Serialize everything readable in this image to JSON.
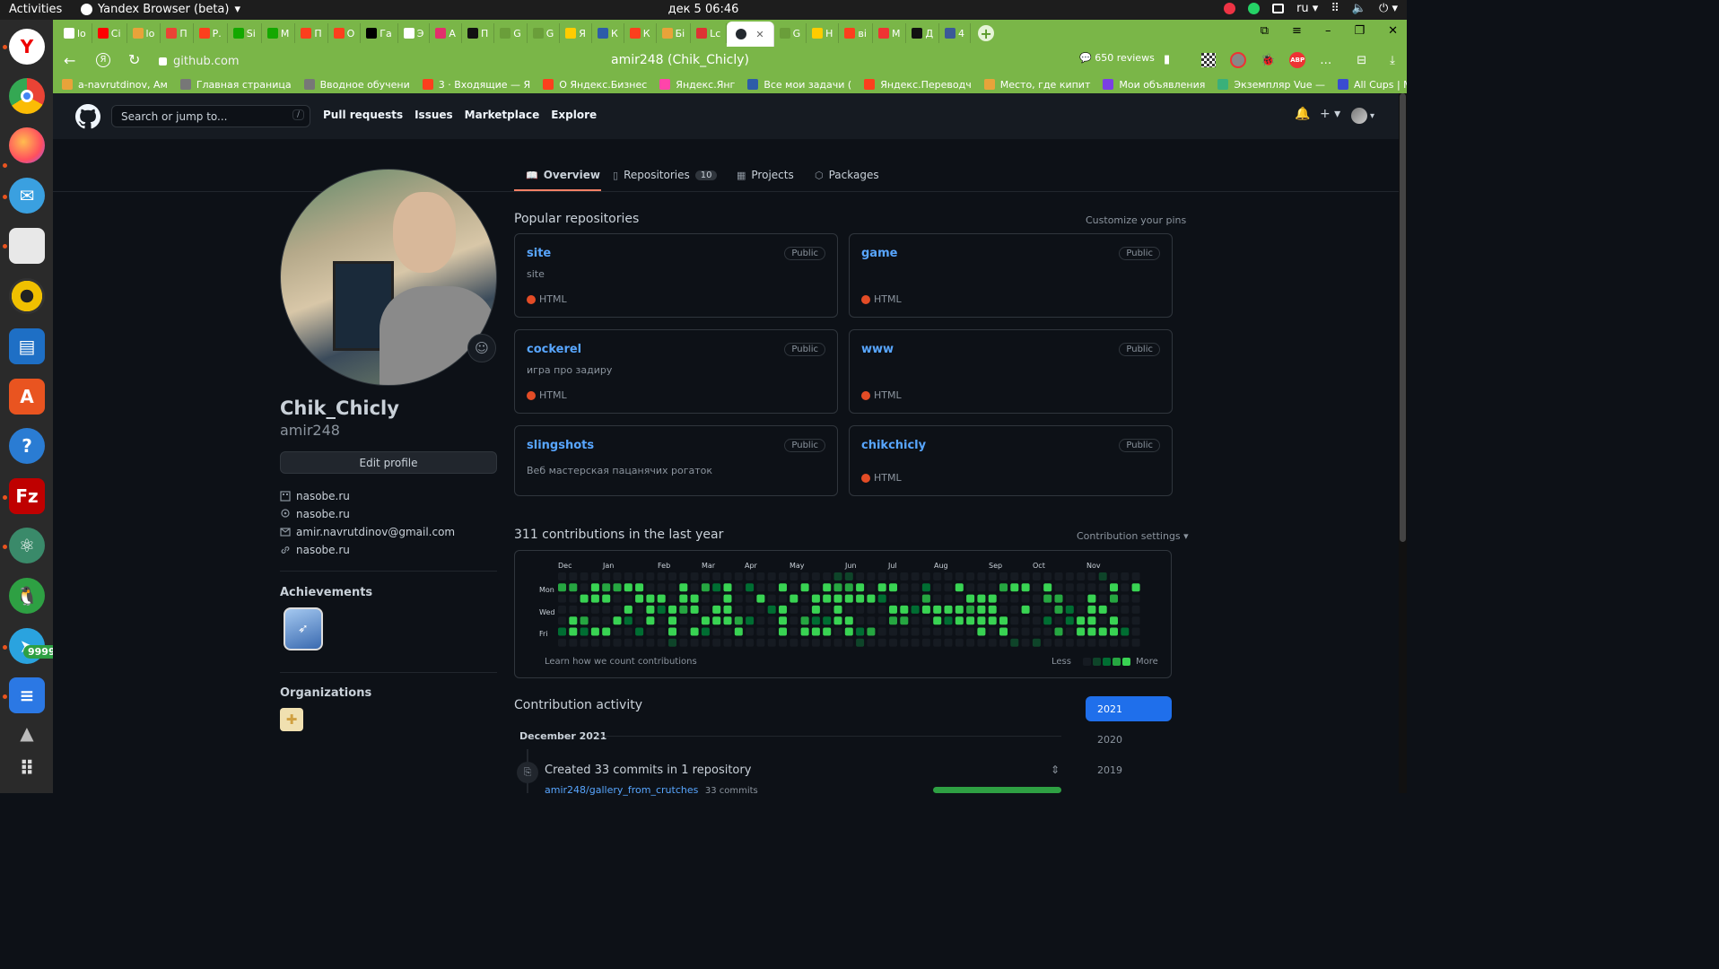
{
  "os": {
    "activities": "Activities",
    "browser_name": "Yandex Browser (beta)",
    "clock": "дек 5  06:46",
    "lang": "ru"
  },
  "browser": {
    "address": "github.com",
    "page_title": "amir248 (Chik_Chicly)",
    "reviews": "650 reviews",
    "tabs": [
      {
        "label": "lo",
        "color": "#ffffff"
      },
      {
        "label": "Ci",
        "color": "#ff0000"
      },
      {
        "label": "lo",
        "color": "#e8a33a"
      },
      {
        "label": "П",
        "color": "#ea4335"
      },
      {
        "label": "Р.",
        "color": "#fc3f1d"
      },
      {
        "label": "Si",
        "color": "#14a800"
      },
      {
        "label": "М",
        "color": "#14a800"
      },
      {
        "label": "П",
        "color": "#fc3f1d"
      },
      {
        "label": "О",
        "color": "#fc3f1d"
      },
      {
        "label": "Га",
        "color": "#000000"
      },
      {
        "label": "Э",
        "color": "#ffffff"
      },
      {
        "label": "А",
        "color": "#e1306c"
      },
      {
        "label": "П",
        "color": "#111111"
      },
      {
        "label": "G",
        "color": "#6a9e3a"
      },
      {
        "label": "G",
        "color": "#6a9e3a"
      },
      {
        "label": "Я",
        "color": "#ffcc00"
      },
      {
        "label": "К",
        "color": "#2d5ca8"
      },
      {
        "label": "К",
        "color": "#fc3f1d"
      },
      {
        "label": "Бі",
        "color": "#e8a33a"
      },
      {
        "label": "Lc",
        "color": "#d33"
      },
      {
        "label": "",
        "color": "#24292f",
        "active": true
      },
      {
        "label": "G",
        "color": "#6a9e3a"
      },
      {
        "label": "Н",
        "color": "#ffcc00"
      },
      {
        "label": "ві",
        "color": "#fc3f1d"
      },
      {
        "label": "М",
        "color": "#e33"
      },
      {
        "label": "Д",
        "color": "#111111"
      },
      {
        "label": "4",
        "color": "#3b5998"
      }
    ],
    "bookmarks": [
      {
        "label": "a-navrutdinov, Ам",
        "color": "#e8a33a"
      },
      {
        "label": "Главная страница",
        "color": "#777777"
      },
      {
        "label": "Вводное обучени",
        "color": "#777777"
      },
      {
        "label": "3 · Входящие — Я",
        "color": "#fc3f1d"
      },
      {
        "label": "О Яндекс.Бизнес",
        "color": "#fc3f1d"
      },
      {
        "label": "Яндекс.Янг",
        "color": "#f4a"
      },
      {
        "label": "Все мои задачи (",
        "color": "#2d5ca8"
      },
      {
        "label": "Яндекс.Переводч",
        "color": "#fc3f1d"
      },
      {
        "label": "Место, где кипит",
        "color": "#e8a33a"
      },
      {
        "label": "Мои объявления",
        "color": "#7b3fe4"
      },
      {
        "label": "Экземпляр Vue —",
        "color": "#3ab07a"
      },
      {
        "label": "All Cups | Мой пр",
        "color": "#3a4bd1"
      }
    ]
  },
  "github": {
    "search_placeholder": "Search or jump to...",
    "search_key": "/",
    "nav": [
      "Pull requests",
      "Issues",
      "Marketplace",
      "Explore"
    ],
    "tabs": [
      {
        "label": "Overview",
        "count": ""
      },
      {
        "label": "Repositories",
        "count": "10"
      },
      {
        "label": "Projects",
        "count": ""
      },
      {
        "label": "Packages",
        "count": ""
      }
    ],
    "profile": {
      "name": "Chik_Chicly",
      "login": "amir248",
      "edit_label": "Edit profile",
      "company": "nasobe.ru",
      "location": "nasobe.ru",
      "email": "amir.navrutdinov@gmail.com",
      "website": "nasobe.ru",
      "achievements_title": "Achievements",
      "orgs_title": "Organizations"
    },
    "popular": {
      "title": "Popular repositories",
      "customize": "Customize your pins",
      "repos": [
        {
          "name": "site",
          "badge": "Public",
          "desc": "site",
          "lang": "HTML"
        },
        {
          "name": "game",
          "badge": "Public",
          "desc": "",
          "lang": "HTML"
        },
        {
          "name": "cockerel",
          "badge": "Public",
          "desc": "игра про задиру",
          "lang": "HTML"
        },
        {
          "name": "www",
          "badge": "Public",
          "desc": "",
          "lang": "HTML"
        },
        {
          "name": "slingshots",
          "badge": "Public",
          "desc": "Веб мастерская пацанячих рогаток",
          "lang": ""
        },
        {
          "name": "chikchicly",
          "badge": "Public",
          "desc": "",
          "lang": "HTML"
        }
      ]
    },
    "contrib": {
      "title": "311 contributions in the last year",
      "settings": "Contribution settings ▾",
      "months": [
        "Dec",
        "Jan",
        "Feb",
        "Mar",
        "Apr",
        "May",
        "Jun",
        "Jul",
        "Aug",
        "Sep",
        "Oct",
        "Nov"
      ],
      "days": [
        "Mon",
        "Wed",
        "Fri"
      ],
      "learn": "Learn how we count contributions",
      "less": "Less",
      "more": "More",
      "colors": [
        "#161b22",
        "#0e4429",
        "#006d32",
        "#26a641",
        "#39d353"
      ]
    },
    "activity": {
      "title": "Contribution activity",
      "month": "December 2021",
      "event": "Created 33 commits in 1 repository",
      "repo_link": "amir248/gallery_from_crutches",
      "commits": "33 commits",
      "years": [
        "2021",
        "2020",
        "2019"
      ]
    }
  }
}
